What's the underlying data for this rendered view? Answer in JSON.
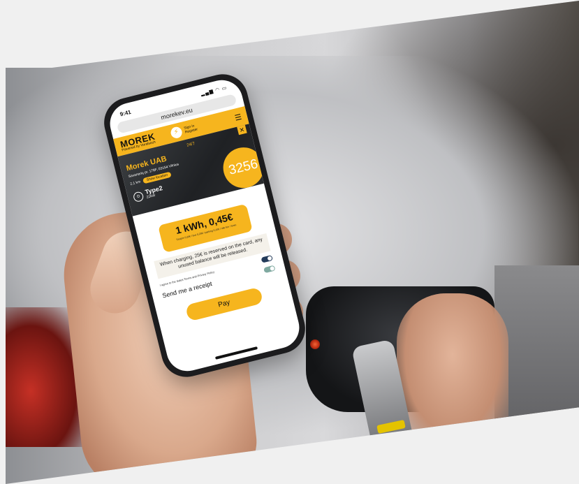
{
  "phone": {
    "status": {
      "time": "9:41",
      "icons": "▂▄▆ ◠ ▭"
    },
    "browser": {
      "url": "morekev.eu"
    },
    "header": {
      "brand_name": "MOREK",
      "brand_sub": "Powered by Voralsoch",
      "sign_in": "Sign in",
      "register": "Register",
      "menu_icon": "menu-icon"
    },
    "station": {
      "hours": "24/7",
      "name": "Morek UAB",
      "address": "Savanorių pr. 178F, 03154 Vilnius",
      "distance": "2,1 km",
      "show_location": "Show location",
      "connector_name": "Type2",
      "connector_power": "22kW",
      "code": "3256"
    },
    "pricing": {
      "price": "1 kWh, 0,45€",
      "note": "Sesijos 0,20€ / bus 0,20€ / parking 0,10€ / Idle fee / 5min"
    },
    "info": "When charging, 25€ is reserved on the card, any unused balance will be released.",
    "terms": "I agree to the Sales Terms and Privacy Policy",
    "receipt_label": "Send me a receipt",
    "pay_label": "Pay",
    "colors": {
      "accent": "#f6b51e",
      "toggle_on": "#233b5a",
      "toggle_teal": "#7fa9a0"
    }
  }
}
